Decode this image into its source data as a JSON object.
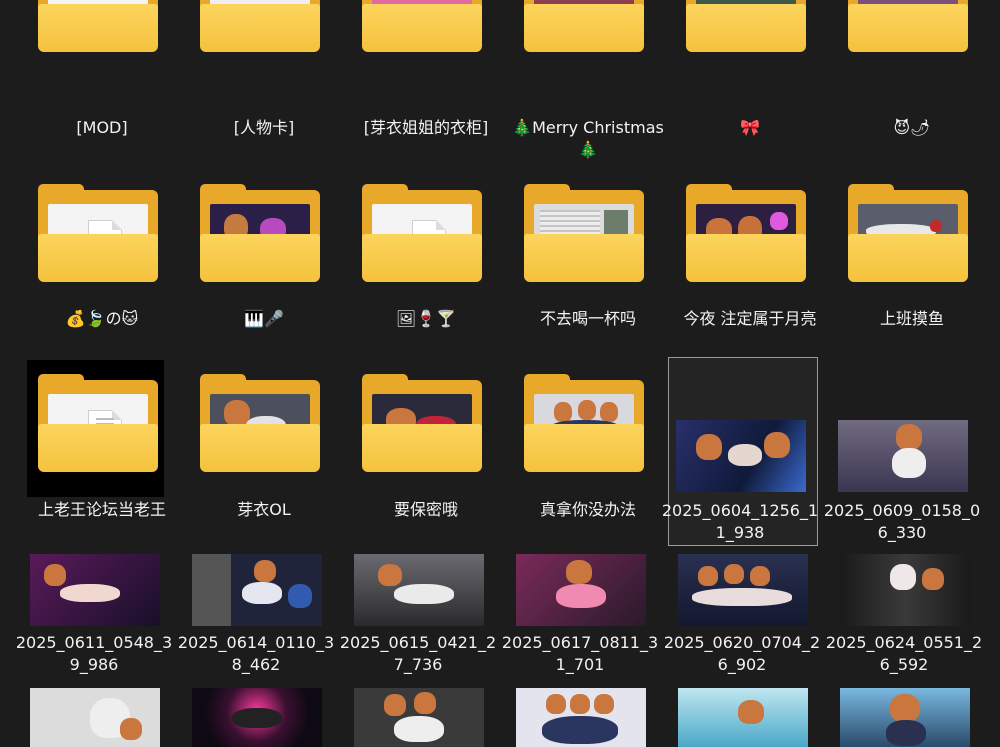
{
  "explorer": {
    "items": [
      {
        "label": "[MOD]"
      },
      {
        "label": "[人物卡]"
      },
      {
        "label": "[芽衣姐姐的衣柜]"
      },
      {
        "label": "🎄Merry Christmas🎄"
      },
      {
        "label": "🎀"
      },
      {
        "label": "😈🌶"
      },
      {
        "label": "💰🍃の🐱"
      },
      {
        "label": "🎹🎤"
      },
      {
        "label": "🖼🍷🍸"
      },
      {
        "label": "不去喝一杯吗"
      },
      {
        "label": "今夜 注定属于月亮"
      },
      {
        "label": "上班摸鱼"
      },
      {
        "label": "上老王论坛当老王"
      },
      {
        "label": "芽衣OL"
      },
      {
        "label": "要保密哦"
      },
      {
        "label": "真拿你没办法"
      },
      {
        "label": "2025_0604_1256_11_938"
      },
      {
        "label": "2025_0609_0158_06_330"
      },
      {
        "label": "2025_0611_0548_39_986"
      },
      {
        "label": "2025_0614_0110_38_462"
      },
      {
        "label": "2025_0615_0421_27_736"
      },
      {
        "label": "2025_0617_0811_31_701"
      },
      {
        "label": "2025_0620_0704_26_902"
      },
      {
        "label": "2025_0624_0551_26_592"
      }
    ]
  },
  "colors": {
    "background": "#1c1c1c",
    "folder_back": "#e8a92b",
    "folder_front": "#fcd45d",
    "selection_border": "#9a9a9a"
  }
}
